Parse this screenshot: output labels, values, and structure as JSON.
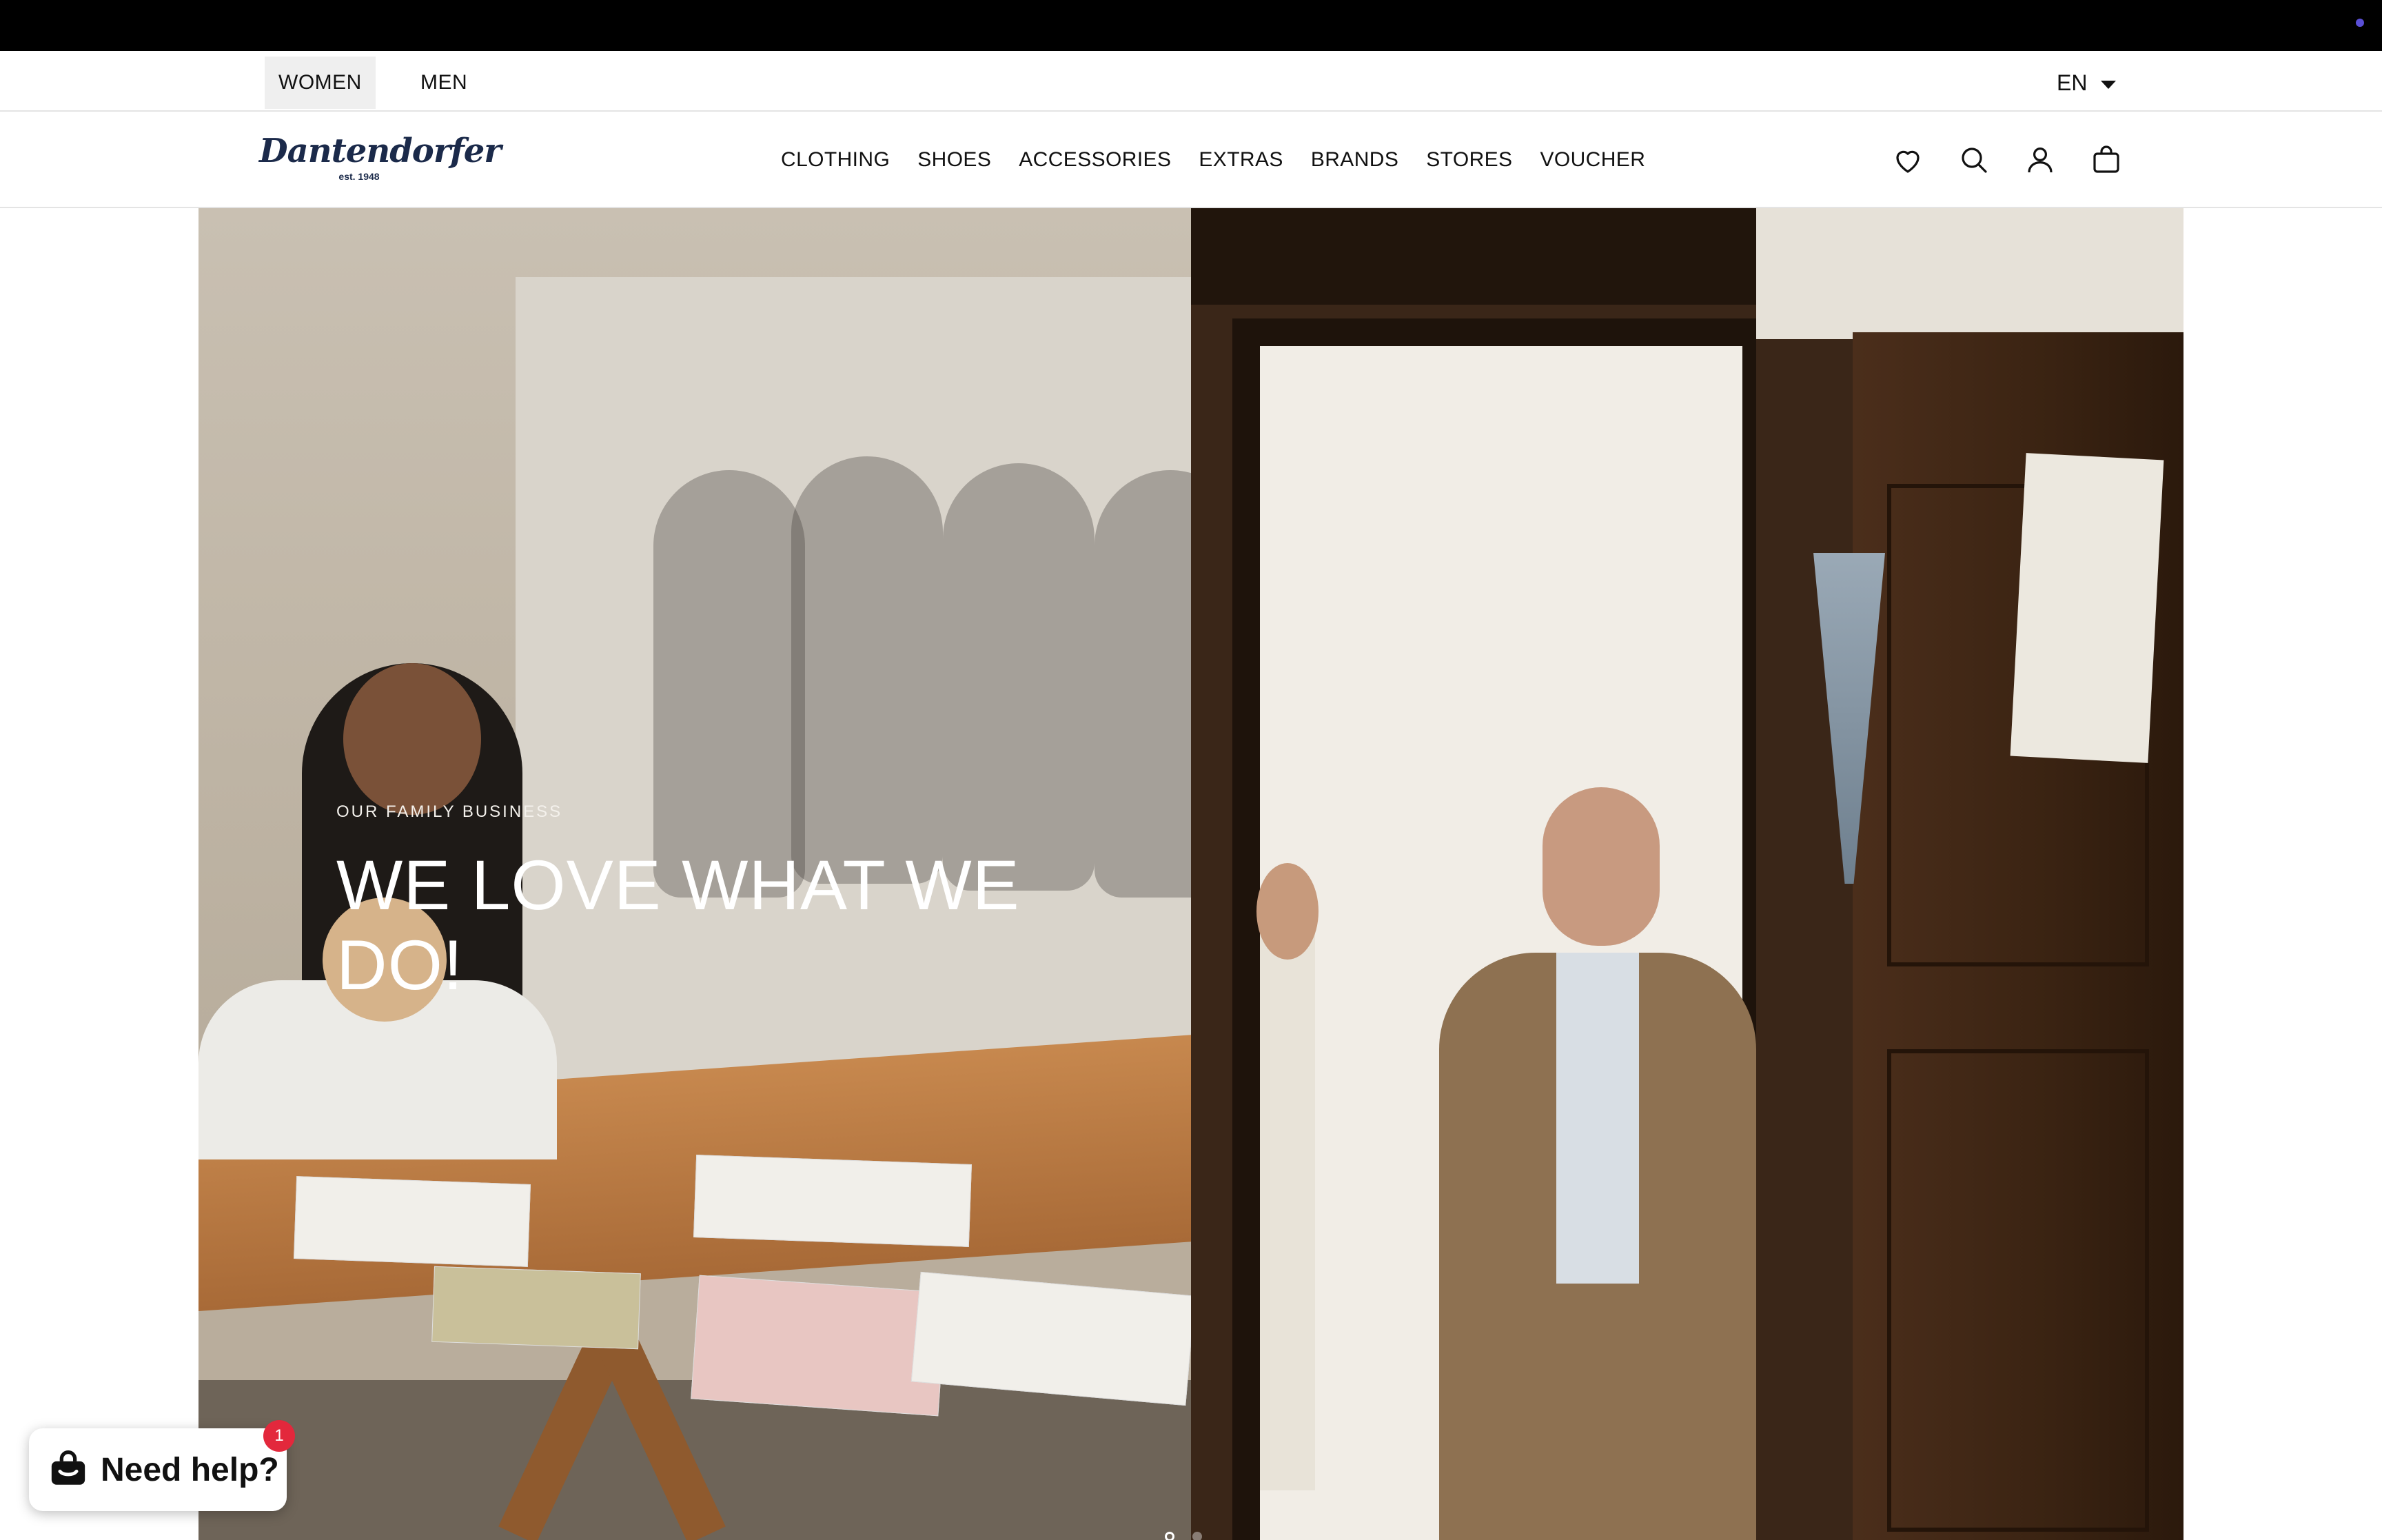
{
  "gender_tabs": [
    {
      "label": "WOMEN",
      "active": true
    },
    {
      "label": "MEN",
      "active": false
    }
  ],
  "language": {
    "selected": "EN",
    "icon": "caret-down-icon"
  },
  "logo": {
    "word": "Dantendorfer",
    "tagline": "est. 1948"
  },
  "nav": {
    "items": [
      "CLOTHING",
      "SHOES",
      "ACCESSORIES",
      "EXTRAS",
      "BRANDS",
      "STORES",
      "VOUCHER"
    ]
  },
  "header_icons": [
    "heart-icon",
    "search-icon",
    "account-icon",
    "cart-icon"
  ],
  "hero": {
    "eyebrow": "OUR FAMILY BUSINESS",
    "headline_line1": "WE LOVE WHAT WE",
    "headline_line2": "DO!",
    "slide_count": 2,
    "active_slide": 1
  },
  "help_widget": {
    "label": "Need help?",
    "badge_count": "1",
    "icon": "shopify-bag-icon"
  },
  "colors": {
    "top_bar": "#000000",
    "text": "#111111",
    "logo": "#1b2a4a",
    "badge": "#e3283c",
    "active_tab_bg": "#efefef"
  }
}
